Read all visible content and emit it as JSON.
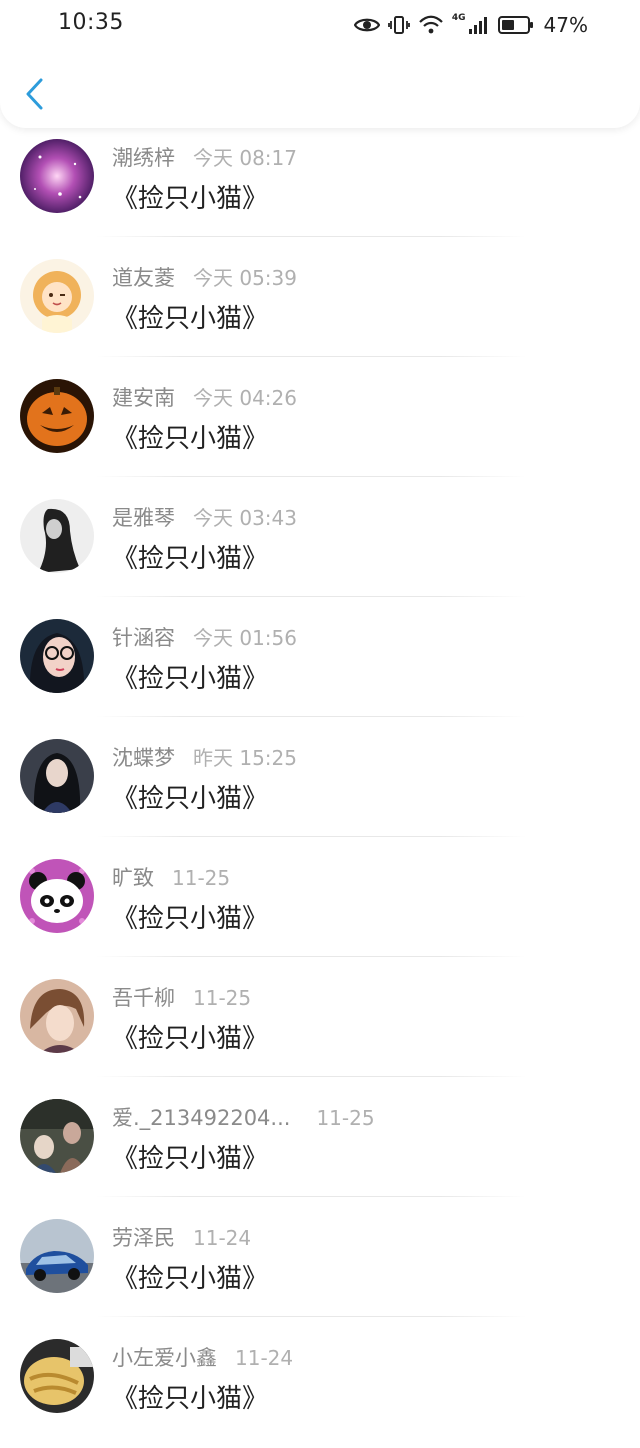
{
  "status_bar": {
    "time": "10:35",
    "battery_percent": "47%",
    "network_label": "4G",
    "icons": [
      "eye-icon",
      "vibrate-icon",
      "wifi-icon",
      "signal-icon",
      "battery-icon"
    ]
  },
  "header": {
    "back_icon": "chevron-left-icon",
    "accent_color": "#2d9cdb"
  },
  "list": {
    "items": [
      {
        "name": "潮绣梓",
        "time": "今天 08:17",
        "title": "《捡只小猫》",
        "avatar": "galaxy"
      },
      {
        "name": "道友菱",
        "time": "今天 05:39",
        "title": "《捡只小猫》",
        "avatar": "cartoon-girl"
      },
      {
        "name": "建安南",
        "time": "今天 04:26",
        "title": "《捡只小猫》",
        "avatar": "pumpkin"
      },
      {
        "name": "是雅琴",
        "time": "今天 03:43",
        "title": "《捡只小猫》",
        "avatar": "bw-portrait"
      },
      {
        "name": "针涵容",
        "time": "今天 01:56",
        "title": "《捡只小猫》",
        "avatar": "glasses-girl"
      },
      {
        "name": "沈蝶梦",
        "time": "昨天 15:25",
        "title": "《捡只小猫》",
        "avatar": "dark-girl"
      },
      {
        "name": "旷致",
        "time": "11-25",
        "title": "《捡只小猫》",
        "avatar": "panda"
      },
      {
        "name": "吾千柳",
        "time": "11-25",
        "title": "《捡只小猫》",
        "avatar": "anime-boy"
      },
      {
        "name": "爱._213492204...",
        "time": "11-25",
        "title": "《捡只小猫》",
        "avatar": "photo-people"
      },
      {
        "name": "劳泽民",
        "time": "11-24",
        "title": "《捡只小猫》",
        "avatar": "blue-car"
      },
      {
        "name": "小左爱小鑫",
        "time": "11-24",
        "title": "《捡只小猫》",
        "avatar": "food"
      }
    ]
  }
}
